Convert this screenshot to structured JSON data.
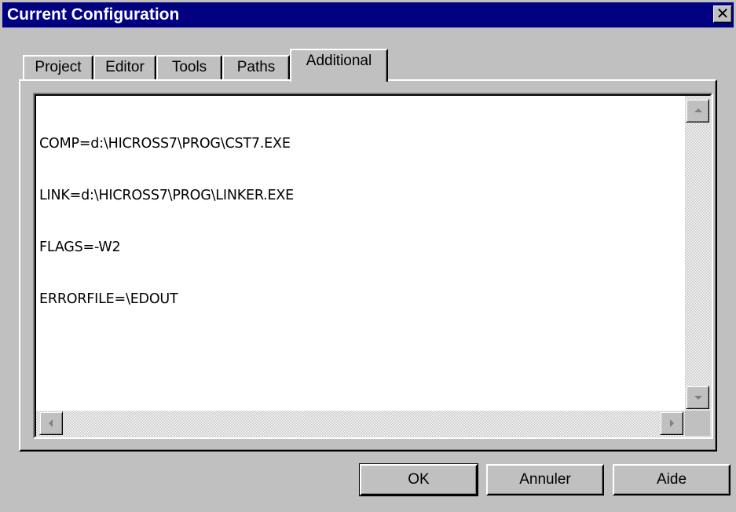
{
  "window": {
    "title": "Current Configuration",
    "close_glyph": "✕"
  },
  "tabs": [
    {
      "label": "Project",
      "active": false
    },
    {
      "label": "Editor",
      "active": false
    },
    {
      "label": "Tools",
      "active": false
    },
    {
      "label": "Paths",
      "active": false
    },
    {
      "label": "Additional",
      "active": true
    }
  ],
  "editor": {
    "lines": [
      "COMP=d:\\HICROSS7\\PROG\\CST7.EXE",
      "LINK=d:\\HICROSS7\\PROG\\LINKER.EXE",
      "FLAGS=-W2",
      "ERRORFILE=\\EDOUT"
    ]
  },
  "buttons": {
    "ok": "OK",
    "cancel": "Annuler",
    "help": "Aide"
  },
  "colors": {
    "titlebar": "#000080",
    "face": "#c0c0c0"
  }
}
